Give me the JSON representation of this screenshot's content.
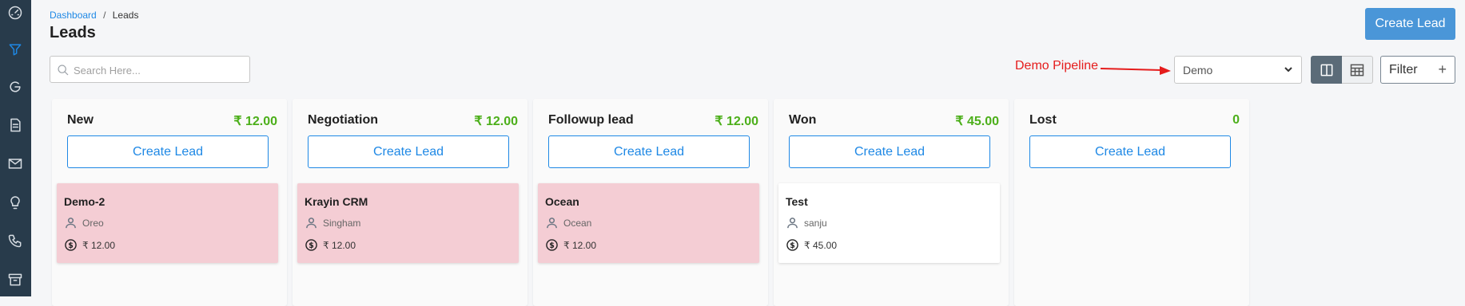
{
  "breadcrumb": {
    "home": "Dashboard",
    "separator": "/",
    "current": "Leads"
  },
  "page_title": "Leads",
  "header": {
    "create_label": "Create Lead"
  },
  "search": {
    "placeholder": "Search Here..."
  },
  "annotation": {
    "label": "Demo Pipeline"
  },
  "pipeline": {
    "selected": "Demo"
  },
  "filter": {
    "label": "Filter",
    "plus": "+"
  },
  "sidebar": {
    "items": [
      {
        "icon": "dashboard-gauge-icon",
        "active": false
      },
      {
        "icon": "filter-funnel-icon",
        "active": true
      },
      {
        "icon": "google-icon",
        "active": false
      },
      {
        "icon": "document-icon",
        "active": false
      },
      {
        "icon": "mail-icon",
        "active": false
      },
      {
        "icon": "lightbulb-icon",
        "active": false
      },
      {
        "icon": "phone-icon",
        "active": false
      },
      {
        "icon": "archive-box-icon",
        "active": false
      }
    ]
  },
  "columns": [
    {
      "title": "New",
      "total": "₹ 12.00",
      "create_label": "Create Lead",
      "lead": {
        "title": "Demo-2",
        "person": "Oreo",
        "amount": "₹ 12.00",
        "style": "pink"
      }
    },
    {
      "title": "Negotiation",
      "total": "₹ 12.00",
      "create_label": "Create Lead",
      "lead": {
        "title": "Krayin CRM",
        "person": "Singham",
        "amount": "₹ 12.00",
        "style": "pink"
      }
    },
    {
      "title": "Followup lead",
      "total": "₹ 12.00",
      "create_label": "Create Lead",
      "lead": {
        "title": "Ocean",
        "person": "Ocean",
        "amount": "₹ 12.00",
        "style": "pink"
      }
    },
    {
      "title": "Won",
      "total": "₹ 45.00",
      "create_label": "Create Lead",
      "lead": {
        "title": "Test",
        "person": "sanju",
        "amount": "₹ 45.00",
        "style": "white"
      }
    },
    {
      "title": "Lost",
      "total": "0",
      "create_label": "Create Lead",
      "lead": null
    }
  ],
  "colors": {
    "accent": "#1e88e5",
    "primary_button": "#4a96d8",
    "total_green": "#4caf1a",
    "sidebar": "#283b4b",
    "card_pink": "#f4cdd4",
    "annotation": "#e51c1c"
  }
}
